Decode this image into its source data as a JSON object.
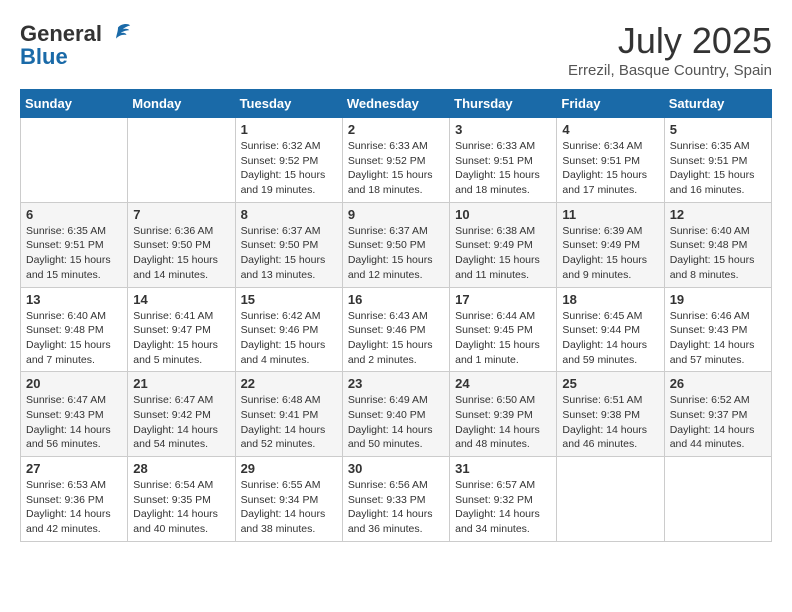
{
  "header": {
    "logo_general": "General",
    "logo_blue": "Blue",
    "month": "July 2025",
    "location": "Errezil, Basque Country, Spain"
  },
  "weekdays": [
    "Sunday",
    "Monday",
    "Tuesday",
    "Wednesday",
    "Thursday",
    "Friday",
    "Saturday"
  ],
  "weeks": [
    [
      {
        "day": "",
        "sunrise": "",
        "sunset": "",
        "daylight": ""
      },
      {
        "day": "",
        "sunrise": "",
        "sunset": "",
        "daylight": ""
      },
      {
        "day": "1",
        "sunrise": "Sunrise: 6:32 AM",
        "sunset": "Sunset: 9:52 PM",
        "daylight": "Daylight: 15 hours and 19 minutes."
      },
      {
        "day": "2",
        "sunrise": "Sunrise: 6:33 AM",
        "sunset": "Sunset: 9:52 PM",
        "daylight": "Daylight: 15 hours and 18 minutes."
      },
      {
        "day": "3",
        "sunrise": "Sunrise: 6:33 AM",
        "sunset": "Sunset: 9:51 PM",
        "daylight": "Daylight: 15 hours and 18 minutes."
      },
      {
        "day": "4",
        "sunrise": "Sunrise: 6:34 AM",
        "sunset": "Sunset: 9:51 PM",
        "daylight": "Daylight: 15 hours and 17 minutes."
      },
      {
        "day": "5",
        "sunrise": "Sunrise: 6:35 AM",
        "sunset": "Sunset: 9:51 PM",
        "daylight": "Daylight: 15 hours and 16 minutes."
      }
    ],
    [
      {
        "day": "6",
        "sunrise": "Sunrise: 6:35 AM",
        "sunset": "Sunset: 9:51 PM",
        "daylight": "Daylight: 15 hours and 15 minutes."
      },
      {
        "day": "7",
        "sunrise": "Sunrise: 6:36 AM",
        "sunset": "Sunset: 9:50 PM",
        "daylight": "Daylight: 15 hours and 14 minutes."
      },
      {
        "day": "8",
        "sunrise": "Sunrise: 6:37 AM",
        "sunset": "Sunset: 9:50 PM",
        "daylight": "Daylight: 15 hours and 13 minutes."
      },
      {
        "day": "9",
        "sunrise": "Sunrise: 6:37 AM",
        "sunset": "Sunset: 9:50 PM",
        "daylight": "Daylight: 15 hours and 12 minutes."
      },
      {
        "day": "10",
        "sunrise": "Sunrise: 6:38 AM",
        "sunset": "Sunset: 9:49 PM",
        "daylight": "Daylight: 15 hours and 11 minutes."
      },
      {
        "day": "11",
        "sunrise": "Sunrise: 6:39 AM",
        "sunset": "Sunset: 9:49 PM",
        "daylight": "Daylight: 15 hours and 9 minutes."
      },
      {
        "day": "12",
        "sunrise": "Sunrise: 6:40 AM",
        "sunset": "Sunset: 9:48 PM",
        "daylight": "Daylight: 15 hours and 8 minutes."
      }
    ],
    [
      {
        "day": "13",
        "sunrise": "Sunrise: 6:40 AM",
        "sunset": "Sunset: 9:48 PM",
        "daylight": "Daylight: 15 hours and 7 minutes."
      },
      {
        "day": "14",
        "sunrise": "Sunrise: 6:41 AM",
        "sunset": "Sunset: 9:47 PM",
        "daylight": "Daylight: 15 hours and 5 minutes."
      },
      {
        "day": "15",
        "sunrise": "Sunrise: 6:42 AM",
        "sunset": "Sunset: 9:46 PM",
        "daylight": "Daylight: 15 hours and 4 minutes."
      },
      {
        "day": "16",
        "sunrise": "Sunrise: 6:43 AM",
        "sunset": "Sunset: 9:46 PM",
        "daylight": "Daylight: 15 hours and 2 minutes."
      },
      {
        "day": "17",
        "sunrise": "Sunrise: 6:44 AM",
        "sunset": "Sunset: 9:45 PM",
        "daylight": "Daylight: 15 hours and 1 minute."
      },
      {
        "day": "18",
        "sunrise": "Sunrise: 6:45 AM",
        "sunset": "Sunset: 9:44 PM",
        "daylight": "Daylight: 14 hours and 59 minutes."
      },
      {
        "day": "19",
        "sunrise": "Sunrise: 6:46 AM",
        "sunset": "Sunset: 9:43 PM",
        "daylight": "Daylight: 14 hours and 57 minutes."
      }
    ],
    [
      {
        "day": "20",
        "sunrise": "Sunrise: 6:47 AM",
        "sunset": "Sunset: 9:43 PM",
        "daylight": "Daylight: 14 hours and 56 minutes."
      },
      {
        "day": "21",
        "sunrise": "Sunrise: 6:47 AM",
        "sunset": "Sunset: 9:42 PM",
        "daylight": "Daylight: 14 hours and 54 minutes."
      },
      {
        "day": "22",
        "sunrise": "Sunrise: 6:48 AM",
        "sunset": "Sunset: 9:41 PM",
        "daylight": "Daylight: 14 hours and 52 minutes."
      },
      {
        "day": "23",
        "sunrise": "Sunrise: 6:49 AM",
        "sunset": "Sunset: 9:40 PM",
        "daylight": "Daylight: 14 hours and 50 minutes."
      },
      {
        "day": "24",
        "sunrise": "Sunrise: 6:50 AM",
        "sunset": "Sunset: 9:39 PM",
        "daylight": "Daylight: 14 hours and 48 minutes."
      },
      {
        "day": "25",
        "sunrise": "Sunrise: 6:51 AM",
        "sunset": "Sunset: 9:38 PM",
        "daylight": "Daylight: 14 hours and 46 minutes."
      },
      {
        "day": "26",
        "sunrise": "Sunrise: 6:52 AM",
        "sunset": "Sunset: 9:37 PM",
        "daylight": "Daylight: 14 hours and 44 minutes."
      }
    ],
    [
      {
        "day": "27",
        "sunrise": "Sunrise: 6:53 AM",
        "sunset": "Sunset: 9:36 PM",
        "daylight": "Daylight: 14 hours and 42 minutes."
      },
      {
        "day": "28",
        "sunrise": "Sunrise: 6:54 AM",
        "sunset": "Sunset: 9:35 PM",
        "daylight": "Daylight: 14 hours and 40 minutes."
      },
      {
        "day": "29",
        "sunrise": "Sunrise: 6:55 AM",
        "sunset": "Sunset: 9:34 PM",
        "daylight": "Daylight: 14 hours and 38 minutes."
      },
      {
        "day": "30",
        "sunrise": "Sunrise: 6:56 AM",
        "sunset": "Sunset: 9:33 PM",
        "daylight": "Daylight: 14 hours and 36 minutes."
      },
      {
        "day": "31",
        "sunrise": "Sunrise: 6:57 AM",
        "sunset": "Sunset: 9:32 PM",
        "daylight": "Daylight: 14 hours and 34 minutes."
      },
      {
        "day": "",
        "sunrise": "",
        "sunset": "",
        "daylight": ""
      },
      {
        "day": "",
        "sunrise": "",
        "sunset": "",
        "daylight": ""
      }
    ]
  ]
}
